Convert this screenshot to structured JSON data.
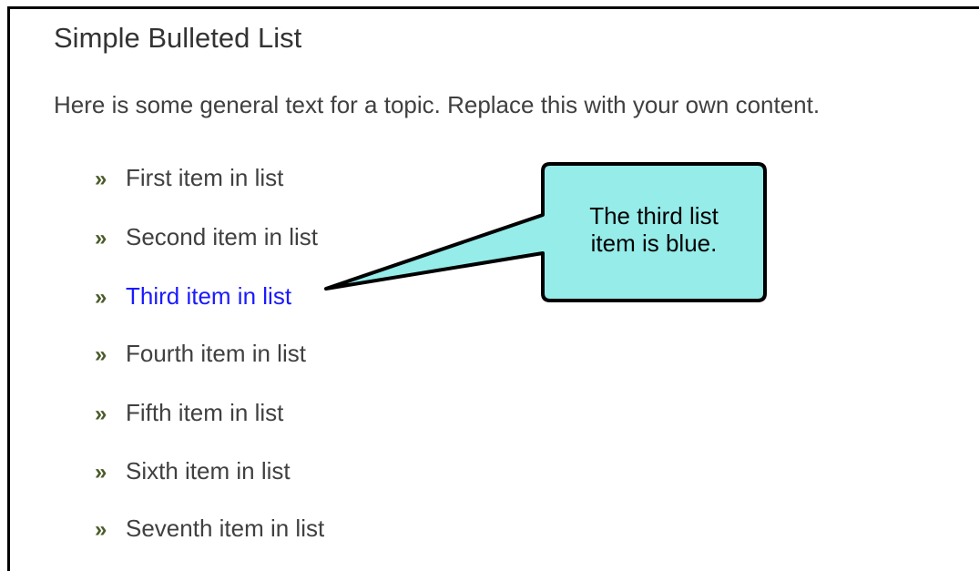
{
  "title": "Simple Bulleted List",
  "intro": "Here is some general text for a topic. Replace this with your own content.",
  "bullet_glyph": "»",
  "items": [
    {
      "label": "First item in list"
    },
    {
      "label": "Second item in list"
    },
    {
      "label": "Third item in list",
      "color": "#1a1aff"
    },
    {
      "label": "Fourth item in list"
    },
    {
      "label": "Fifth item in list"
    },
    {
      "label": "Sixth item in list"
    },
    {
      "label": "Seventh item in list"
    }
  ],
  "callout": {
    "text_line1": "The third list",
    "text_line2": "item is blue.",
    "fill": "#95ece9",
    "stroke": "#000000"
  },
  "colors": {
    "text": "#404040",
    "bullet": "#4b5b2a",
    "highlight": "#1a1aff"
  }
}
